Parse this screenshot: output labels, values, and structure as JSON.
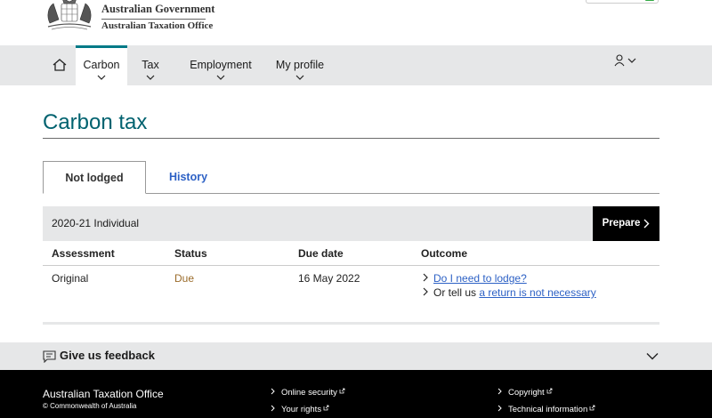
{
  "header": {
    "gov_name": "Australian Government",
    "agency_name": "Australian Taxation Office"
  },
  "nav": {
    "items": [
      {
        "label": "Carbon",
        "active": true
      },
      {
        "label": "Tax",
        "active": false
      },
      {
        "label": "Employment",
        "active": false
      },
      {
        "label": "My profile",
        "active": false
      }
    ],
    "icons": [
      "home-icon",
      "user-icon"
    ]
  },
  "page": {
    "title": "Carbon tax"
  },
  "tabs": [
    {
      "label": "Not lodged",
      "active": true
    },
    {
      "label": "History",
      "active": false
    }
  ],
  "year_row": {
    "label": "2020-21 Individual",
    "button": "Prepare"
  },
  "table": {
    "headers": [
      "Assessment",
      "Status",
      "Due date",
      "Outcome"
    ],
    "row": {
      "assessment": "Original",
      "status": "Due",
      "due_date": "16 May 2022",
      "outcome_link1": "Do I need to lodge?",
      "outcome_prefix2": "Or tell us",
      "outcome_link2": "a return is not necessary"
    }
  },
  "feedback": {
    "label": "Give us feedback"
  },
  "footer": {
    "title": "Australian Taxation Office",
    "copyright": "© Commonwealth of Australia",
    "links_col1": [
      "Online security",
      "Your rights"
    ],
    "links_col2": [
      "Copyright",
      "Technical information"
    ]
  },
  "colors": {
    "accent": "#007a87",
    "title": "#00626f",
    "link": "#2d61c5",
    "status_due": "#9a6b2a",
    "nav_bg": "#e6e7e8",
    "footer_bg": "#000000"
  }
}
